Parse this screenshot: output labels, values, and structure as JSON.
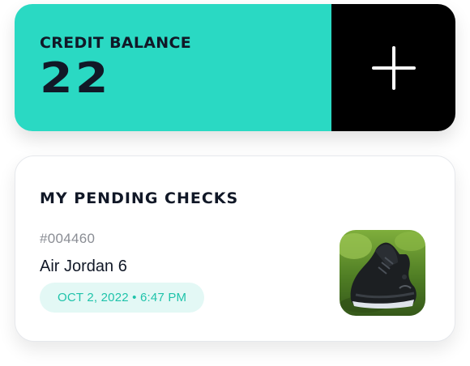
{
  "credit": {
    "label": "CREDIT BALANCE",
    "value": "22",
    "add_icon": "plus-icon"
  },
  "pending": {
    "title": "MY PENDING CHECKS",
    "items": [
      {
        "id": "#004460",
        "name": "Air Jordan 6",
        "datetime": "OCT 2, 2022 • 6:47 PM",
        "thumbnail": "sneaker-photo"
      }
    ]
  },
  "colors": {
    "accent": "#2ad9c3",
    "badge_bg": "#e3f8f5",
    "badge_text": "#1fc3aa",
    "dark": "#111827"
  }
}
